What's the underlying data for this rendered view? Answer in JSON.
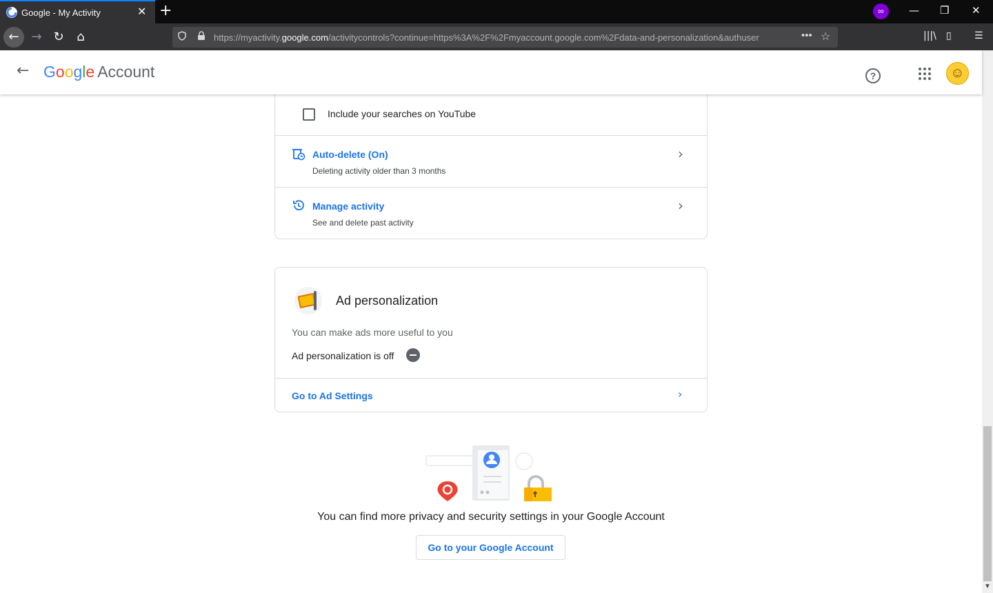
{
  "browser": {
    "tab_title": "Google - My Activity",
    "tab_close": "✕",
    "new_tab": "+",
    "url_prefix": "https://myactivity.",
    "url_domain": "google.com",
    "url_rest": "/activitycontrols?continue=https%3A%2F%2Fmyaccount.google.com%2Fdata-and-personalization&authuser",
    "url_more": "•••",
    "private_icon": "∞",
    "window_minimize": "—",
    "window_restore": "❐",
    "window_close": "✕"
  },
  "header": {
    "logo_g1": "G",
    "logo_o1": "o",
    "logo_o2": "o",
    "logo_g2": "g",
    "logo_l": "l",
    "logo_e": "e",
    "logo_account": "Account",
    "help": "?"
  },
  "activity_card": {
    "checkbox_label": "Include your searches on YouTube",
    "checkbox_checked": false,
    "auto_delete_title": "Auto-delete (On)",
    "auto_delete_sub": "Deleting activity older than 3 months",
    "manage_title": "Manage activity",
    "manage_sub": "See and delete past activity"
  },
  "ad_card": {
    "title": "Ad personalization",
    "description": "You can make ads more useful to you",
    "status": "Ad personalization is off",
    "link": "Go to Ad Settings"
  },
  "footer": {
    "text": "You can find more privacy and security settings in your Google Account",
    "button": "Go to your Google Account"
  },
  "colors": {
    "link_blue": "#1a73e8",
    "private_purple": "#8000d7"
  }
}
